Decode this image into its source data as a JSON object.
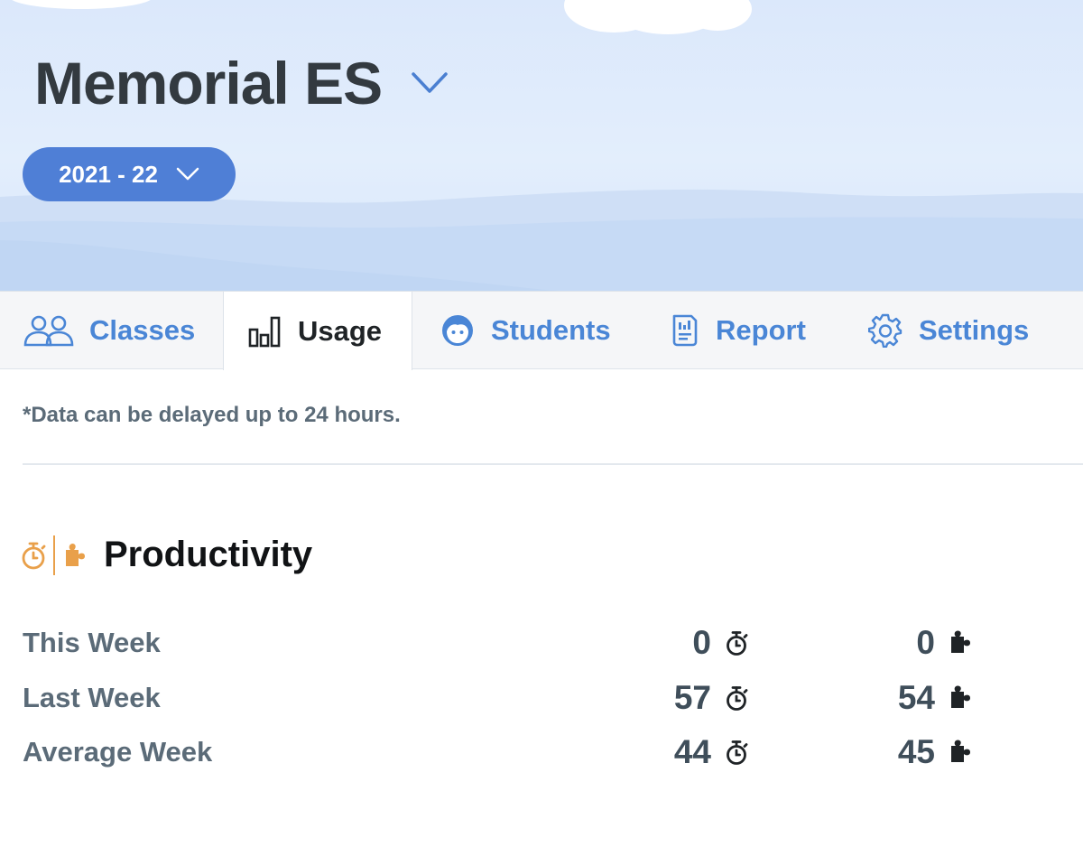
{
  "header": {
    "school_name": "Memorial ES",
    "school_year": "2021 - 22"
  },
  "tabs": [
    {
      "label": "Classes",
      "icon": "people-icon",
      "active": false
    },
    {
      "label": "Usage",
      "icon": "bar-chart-icon",
      "active": true
    },
    {
      "label": "Students",
      "icon": "student-face-icon",
      "active": false
    },
    {
      "label": "Report",
      "icon": "report-icon",
      "active": false
    },
    {
      "label": "Settings",
      "icon": "gear-icon",
      "active": false
    }
  ],
  "notice": "*Data can be delayed up to 24 hours.",
  "productivity": {
    "title": "Productivity",
    "icons": [
      "stopwatch-icon",
      "puzzle-icon"
    ],
    "rows": [
      {
        "label": "This Week",
        "minutes": "0",
        "puzzles": "0"
      },
      {
        "label": "Last Week",
        "minutes": "57",
        "puzzles": "54"
      },
      {
        "label": "Average Week",
        "minutes": "44",
        "puzzles": "45"
      }
    ]
  },
  "colors": {
    "accent": "#4f7fd6",
    "tab_text": "#4a86d6",
    "productivity_icon": "#e9a04a",
    "hero_background": "#dbe8fb"
  }
}
